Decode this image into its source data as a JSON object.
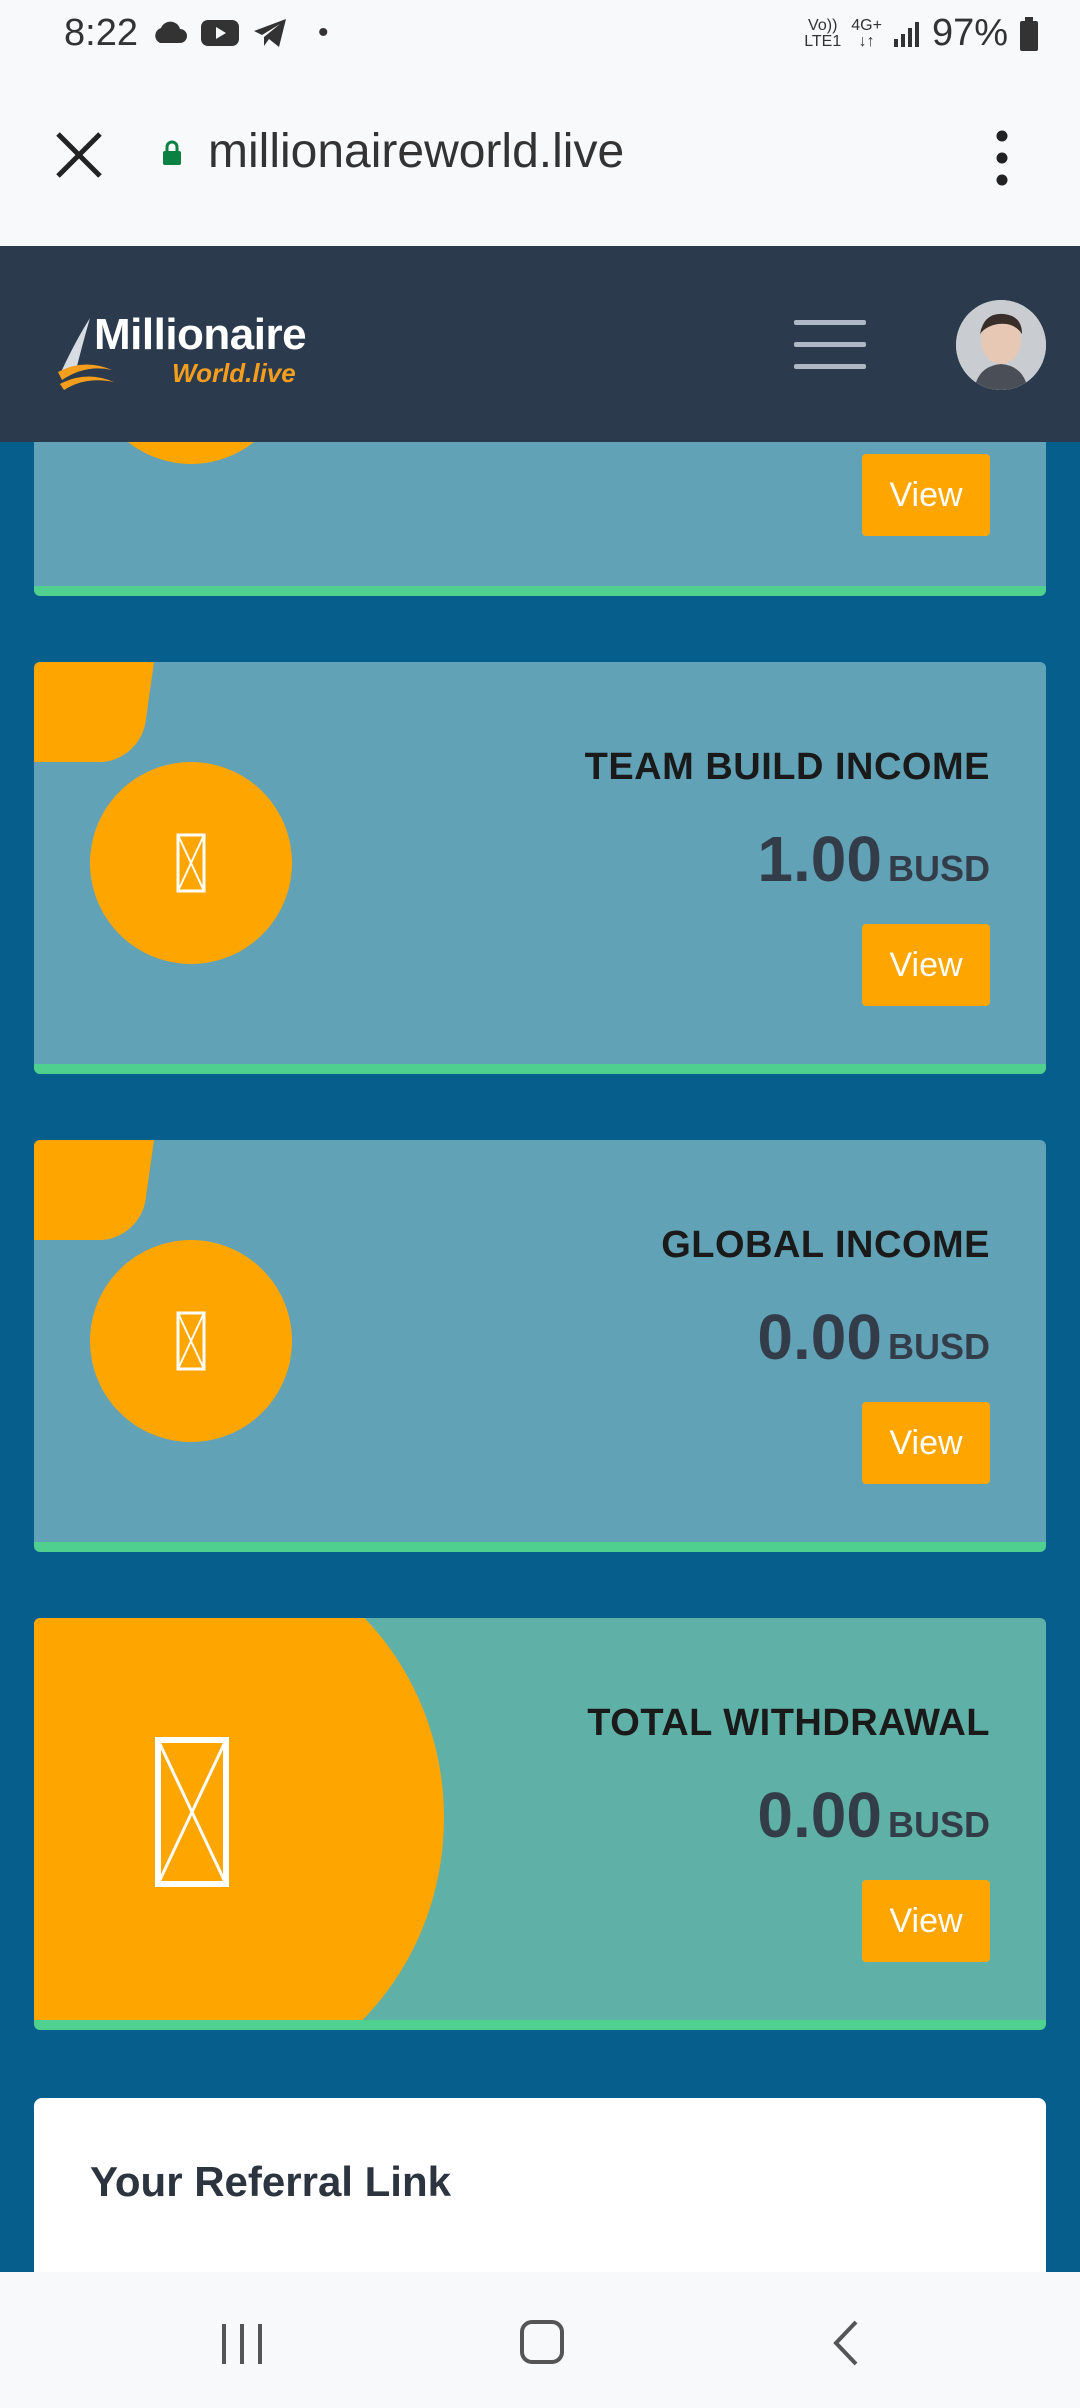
{
  "status_bar": {
    "time": "8:22",
    "dot": "•",
    "net_top": "Vo))",
    "net_bottom": "LTE1",
    "gen_top": "4G+",
    "gen_bottom": "↓↑",
    "battery": "97%"
  },
  "browser": {
    "url": "millionaireworld.live"
  },
  "header": {
    "logo_title": "Millionaire",
    "logo_sub": "World.live"
  },
  "cards": [
    {
      "title": "",
      "value": "",
      "currency": "",
      "button": "View"
    },
    {
      "title": "TEAM BUILD INCOME",
      "value": "1.00",
      "currency": "BUSD",
      "button": "View"
    },
    {
      "title": "GLOBAL INCOME",
      "value": "0.00",
      "currency": "BUSD",
      "button": "View"
    },
    {
      "title": "TOTAL WITHDRAWAL",
      "value": "0.00",
      "currency": "BUSD",
      "button": "View"
    }
  ],
  "referral": {
    "title": "Your Referral Link"
  },
  "colors": {
    "page_bg": "#055e8c",
    "header_bg": "#2b3a4d",
    "card_bg": "#62a2b6",
    "withdrawal_card_bg": "#5fb1a8",
    "accent": "#ffa500",
    "card_border": "#4fd08e"
  }
}
